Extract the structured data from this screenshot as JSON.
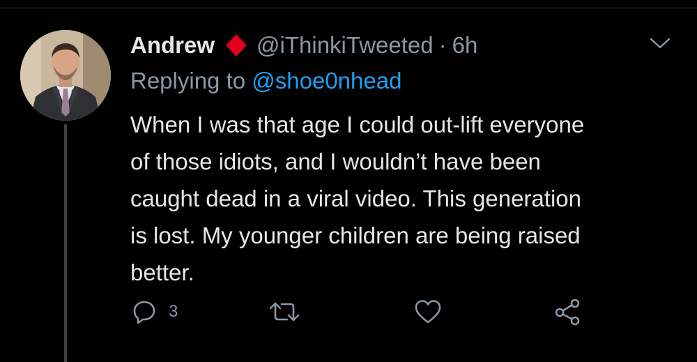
{
  "tweet": {
    "author_name": "Andrew",
    "badge_icon": "red-diamond-icon",
    "handle": "@iThinkiTweeted",
    "separator": "·",
    "time": "6h",
    "replying_prefix": "Replying to ",
    "replying_to": "@shoe0nhead",
    "text": "When I was that age I could out-lift everyone\nof those idiots, and I wouldn’t have been\ncaught dead in a viral video. This generation\nis lost. My younger children are being raised\nbetter.",
    "actions": {
      "reply_icon": "reply-icon",
      "reply_count": "3",
      "retweet_icon": "retweet-icon",
      "like_icon": "heart-icon",
      "share_icon": "share-icon",
      "menu_icon": "chevron-down-icon"
    }
  },
  "colors": {
    "background": "#000000",
    "text": "#e6e6e6",
    "secondary": "#8b98a5",
    "mention": "#1da1f2",
    "badge": "#e0001b",
    "thread_line": "#3d4144"
  }
}
